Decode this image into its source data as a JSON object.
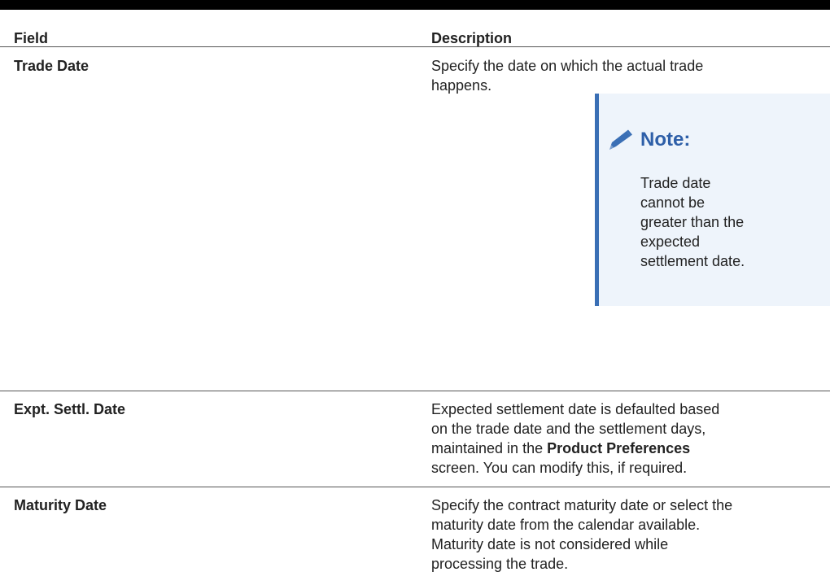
{
  "table": {
    "header": {
      "field": "Field",
      "description": "Description"
    },
    "rows": [
      {
        "field": "Trade Date",
        "description": "Specify the date on which the actual trade\nhappens.",
        "note": {
          "title": "Note:",
          "body": "Trade date\ncannot be\ngreater than the\nexpected\nsettlement date."
        }
      },
      {
        "field": "Expt. Settl. Date",
        "description_before": "Expected settlement date is defaulted based\non the trade date and the settlement days,\nmaintained in the ",
        "description_bold": "Product Preferences",
        "description_after": "\nscreen. You can modify this, if required."
      },
      {
        "field": "Maturity Date",
        "description": "Specify the contract maturity date or select the\nmaturity date from the calendar available.\nMaturity date is not considered while\nprocessing the trade."
      }
    ]
  },
  "colors": {
    "note_accent": "#3a6fb5",
    "note_background": "#eef4fb",
    "note_title": "#2e5fa8"
  },
  "icons": {
    "note_icon": "pencil-icon"
  }
}
